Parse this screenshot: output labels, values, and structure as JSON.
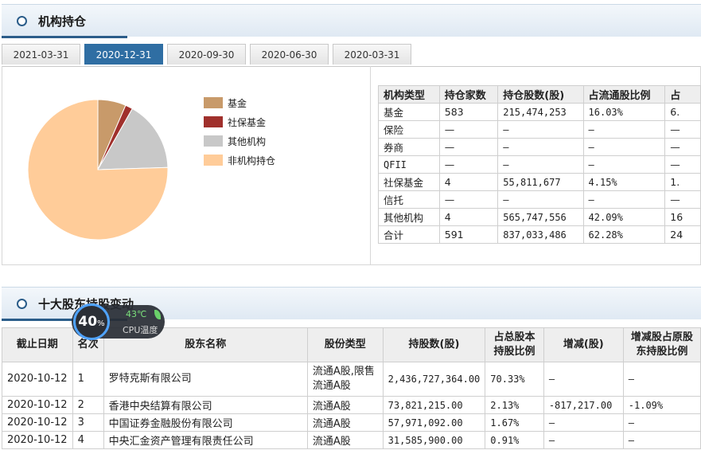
{
  "institutional": {
    "title": "机构持仓",
    "tabs": [
      "2021-03-31",
      "2020-12-31",
      "2020-09-30",
      "2020-06-30",
      "2020-03-31"
    ],
    "active_tab": "2020-12-31",
    "legend": [
      {
        "label": "基金",
        "color": "#c89a6a"
      },
      {
        "label": "社保基金",
        "color": "#a0302c"
      },
      {
        "label": "其他机构",
        "color": "#c8c8c8"
      },
      {
        "label": "非机构持仓",
        "color": "#ffcc99"
      }
    ],
    "columns": [
      "机构类型",
      "持仓家数",
      "持仓股数(股)",
      "占流通股比例",
      "占"
    ],
    "rows": [
      [
        "基金",
        "583",
        "215,474,253",
        "16.03%",
        "6."
      ],
      [
        "保险",
        "—",
        "—",
        "—",
        "—"
      ],
      [
        "券商",
        "—",
        "—",
        "—",
        "—"
      ],
      [
        "QFII",
        "—",
        "—",
        "—",
        "—"
      ],
      [
        "社保基金",
        "4",
        "55,811,677",
        "4.15%",
        "1."
      ],
      [
        "信托",
        "—",
        "—",
        "—",
        "—"
      ],
      [
        "其他机构",
        "4",
        "565,747,556",
        "42.09%",
        "16"
      ],
      [
        "合计",
        "591",
        "837,033,486",
        "62.28%",
        "24"
      ]
    ]
  },
  "chart_data": {
    "type": "pie",
    "categories": [
      "基金",
      "社保基金",
      "其他机构",
      "非机构持仓"
    ],
    "values": [
      6.5,
      1.7,
      16.3,
      75.5
    ],
    "colors": [
      "#c89a6a",
      "#a0302c",
      "#c8c8c8",
      "#ffcc99"
    ]
  },
  "shareholders": {
    "title": "十大股东持股变动",
    "columns": [
      "截止日期",
      "名次",
      "股东名称",
      "股份类型",
      "持股数(股)",
      "占总股本\n持股比例",
      "增减(股)",
      "增减股占原股\n东持股比例"
    ],
    "rows": [
      [
        "2020-10-12",
        "1",
        "罗特克斯有限公司",
        "流通A股,限售\n流通A股",
        "2,436,727,364.00",
        "70.33%",
        "—",
        "—"
      ],
      [
        "2020-10-12",
        "2",
        "香港中央结算有限公司",
        "流通A股",
        "73,821,215.00",
        "2.13%",
        "-817,217.00",
        "-1.09%"
      ],
      [
        "2020-10-12",
        "3",
        "中国证券金融股份有限公司",
        "流通A股",
        "57,971,092.00",
        "1.67%",
        "—",
        "—"
      ],
      [
        "2020-10-12",
        "4",
        "中央汇金资产管理有限责任公司",
        "流通A股",
        "31,585,900.00",
        "0.91%",
        "—",
        "—"
      ]
    ]
  },
  "cpu_widget": {
    "percent": "40",
    "percent_unit": "%",
    "temperature": "43℃",
    "label": "CPU温度"
  }
}
